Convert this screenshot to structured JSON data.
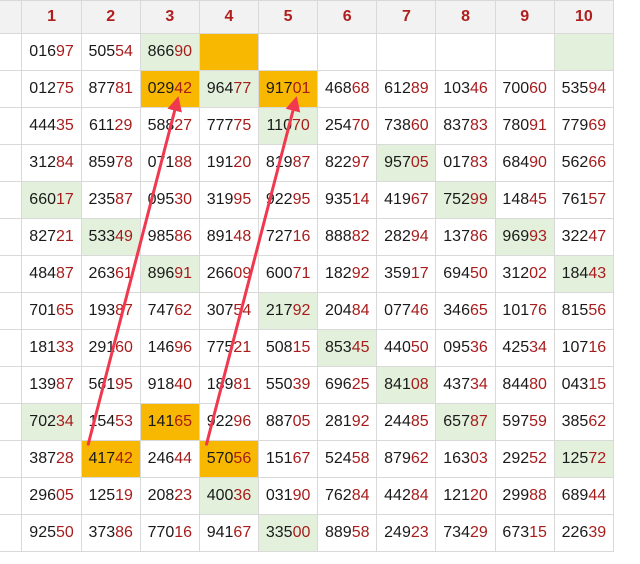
{
  "colors": {
    "header_text": "#b01e1e",
    "highlight_orange": "#f8b700",
    "highlight_green": "#e3f1dc",
    "arrow": "#f0394f"
  },
  "columns": [
    "1",
    "2",
    "3",
    "4",
    "5",
    "6",
    "7",
    "8",
    "9",
    "10"
  ],
  "rows": [
    [
      "01697",
      "50554",
      "86690",
      "",
      "",
      "",
      "",
      "",
      "",
      ""
    ],
    [
      "01275",
      "87781",
      "02942",
      "96477",
      "91701",
      "46868",
      "61289",
      "10346",
      "70060",
      "53594"
    ],
    [
      "44435",
      "61129",
      "58827",
      "77775",
      "11070",
      "25470",
      "73860",
      "83783",
      "78091",
      "77969"
    ],
    [
      "31284",
      "85978",
      "07188",
      "19120",
      "81987",
      "82297",
      "95705",
      "01783",
      "68490",
      "56266"
    ],
    [
      "66017",
      "23587",
      "09530",
      "31995",
      "92295",
      "93514",
      "41967",
      "75299",
      "14845",
      "76157"
    ],
    [
      "82721",
      "53349",
      "98586",
      "89148",
      "72716",
      "88882",
      "28294",
      "13786",
      "96993",
      "32247"
    ],
    [
      "48487",
      "26361",
      "89691",
      "26609",
      "60071",
      "18292",
      "35917",
      "69450",
      "31202",
      "18443"
    ],
    [
      "70165",
      "19387",
      "74762",
      "30754",
      "21792",
      "20484",
      "07746",
      "34665",
      "10176",
      "81556"
    ],
    [
      "18133",
      "29160",
      "14696",
      "77521",
      "50815",
      "85345",
      "44050",
      "09536",
      "42534",
      "10716"
    ],
    [
      "13987",
      "56195",
      "91840",
      "18981",
      "55039",
      "69625",
      "84108",
      "43734",
      "84480",
      "04315"
    ],
    [
      "70234",
      "15453",
      "14165",
      "92296",
      "88705",
      "28192",
      "24485",
      "65787",
      "59759",
      "38562"
    ],
    [
      "38728",
      "41742",
      "24644",
      "57056",
      "15167",
      "52458",
      "87962",
      "16303",
      "29252",
      "12572"
    ],
    [
      "29605",
      "12519",
      "20823",
      "40036",
      "03190",
      "76284",
      "44284",
      "12120",
      "29988",
      "68944"
    ],
    [
      "92550",
      "37386",
      "77016",
      "94167",
      "33500",
      "88958",
      "24923",
      "73429",
      "67315",
      "22639"
    ]
  ],
  "cell_highlights": [
    [
      "",
      "",
      "green",
      "orange",
      "empty",
      "empty",
      "empty",
      "empty",
      "empty",
      "green"
    ],
    [
      "",
      "",
      "orange",
      "green",
      "orange",
      "",
      "",
      "",
      "",
      ""
    ],
    [
      "",
      "",
      "",
      "",
      "green",
      "",
      "",
      "",
      "",
      ""
    ],
    [
      "",
      "",
      "",
      "",
      "",
      "",
      "green",
      "",
      "",
      ""
    ],
    [
      "green",
      "",
      "",
      "",
      "",
      "",
      "",
      "green",
      "",
      ""
    ],
    [
      "",
      "green",
      "",
      "",
      "",
      "",
      "",
      "",
      "green",
      ""
    ],
    [
      "",
      "",
      "green",
      "",
      "",
      "",
      "",
      "",
      "",
      "green"
    ],
    [
      "",
      "",
      "",
      "",
      "green",
      "",
      "",
      "",
      "",
      ""
    ],
    [
      "",
      "",
      "",
      "",
      "",
      "green",
      "",
      "",
      "",
      ""
    ],
    [
      "",
      "",
      "",
      "",
      "",
      "",
      "green",
      "",
      "",
      ""
    ],
    [
      "green",
      "",
      "orange",
      "",
      "",
      "",
      "",
      "green",
      "",
      ""
    ],
    [
      "",
      "orange",
      "",
      "orange",
      "",
      "",
      "",
      "",
      "",
      "green"
    ],
    [
      "",
      "",
      "",
      "green",
      "",
      "",
      "",
      "",
      "",
      ""
    ],
    [
      "",
      "",
      "",
      "",
      "green",
      "",
      "",
      "",
      "",
      ""
    ]
  ],
  "arrows": [
    {
      "from": "41742",
      "to": "02942"
    },
    {
      "from": "57056",
      "to": "91701"
    }
  ]
}
